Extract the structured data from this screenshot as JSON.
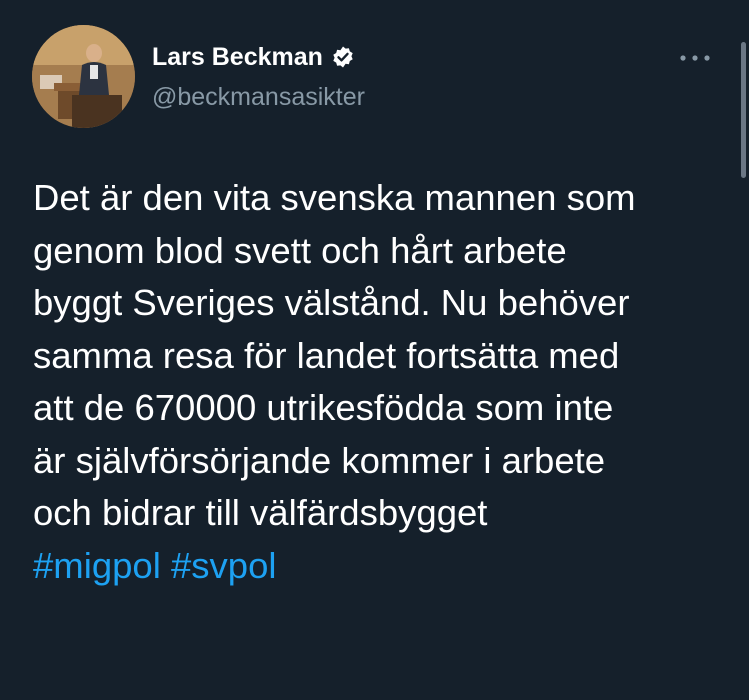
{
  "author": {
    "display_name": "Lars Beckman",
    "handle": "@beckmansasikter",
    "verified": true,
    "avatar_icon": "profile-photo"
  },
  "menu_icon": "more-horizontal-icon",
  "tweet": {
    "lines": [
      "Det är den vita svenska mannen som",
      "genom blod svett och hårt arbete",
      "byggt Sveriges välstånd. Nu behöver",
      "samma resa för landet fortsätta med",
      "att de 670000 utrikesfödda som inte",
      "är självförsörjande kommer i arbete",
      "och bidrar till välfärdsbygget"
    ],
    "hashtags": [
      "#migpol",
      "#svpol"
    ]
  },
  "colors": {
    "background": "#15202b",
    "text": "#ffffff",
    "secondary_text": "#8899a6",
    "link": "#1da1f2"
  }
}
